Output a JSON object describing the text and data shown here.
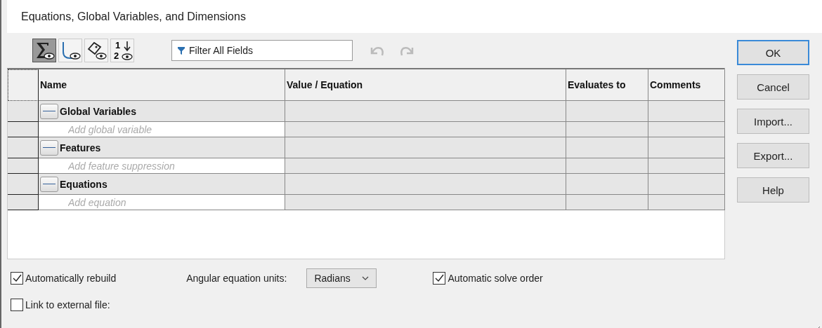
{
  "window": {
    "title": "Equations, Global Variables, and Dimensions"
  },
  "toolbar": {
    "buttons": [
      {
        "kind": "sigma",
        "selected": true
      },
      {
        "kind": "curve",
        "selected": false
      },
      {
        "kind": "tag",
        "selected": false
      },
      {
        "kind": "sort",
        "selected": false,
        "digits": [
          "1",
          "2"
        ]
      }
    ],
    "filter": {
      "placeholder": "Filter All Fields"
    },
    "undo": {
      "disabled": true
    },
    "redo": {
      "disabled": true
    }
  },
  "table": {
    "columns": [
      "Name",
      "Value / Equation",
      "Evaluates to",
      "Comments"
    ],
    "groups": [
      {
        "name": "Global Variables",
        "expanded": true,
        "add_placeholder": "Add global variable"
      },
      {
        "name": "Features",
        "expanded": true,
        "add_placeholder": "Add feature suppression"
      },
      {
        "name": "Equations",
        "expanded": true,
        "add_placeholder": "Add equation"
      }
    ]
  },
  "buttons": [
    {
      "label": "OK",
      "default": true
    },
    {
      "label": "Cancel",
      "default": false
    },
    {
      "label": "Import...",
      "default": false
    },
    {
      "label": "Export...",
      "default": false
    },
    {
      "label": "Help",
      "default": false
    }
  ],
  "options": {
    "auto_rebuild": {
      "label": "Automatically rebuild",
      "checked": true
    },
    "angular_units": {
      "label": "Angular equation units:",
      "value": "Radians"
    },
    "auto_solve": {
      "label": "Automatic solve order",
      "checked": true
    },
    "link_external": {
      "label": "Link to external file:",
      "checked": false
    }
  }
}
